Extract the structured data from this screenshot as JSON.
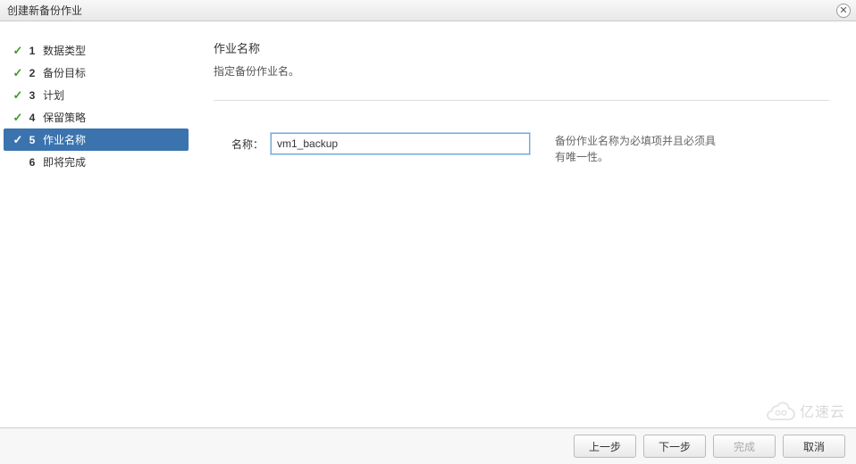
{
  "window": {
    "title": "创建新备份作业",
    "close_glyph": "✕"
  },
  "steps": [
    {
      "num": "1",
      "label": "数据类型",
      "done": true,
      "active": false
    },
    {
      "num": "2",
      "label": "备份目标",
      "done": true,
      "active": false
    },
    {
      "num": "3",
      "label": "计划",
      "done": true,
      "active": false
    },
    {
      "num": "4",
      "label": "保留策略",
      "done": true,
      "active": false
    },
    {
      "num": "5",
      "label": "作业名称",
      "done": true,
      "active": true
    },
    {
      "num": "6",
      "label": "即将完成",
      "done": false,
      "active": false
    }
  ],
  "check_glyph": "✓",
  "main": {
    "title": "作业名称",
    "subtitle": "指定备份作业名。",
    "field_label": "名称：",
    "field_value": "vm1_backup",
    "hint": "备份作业名称为必填项并且必须具有唯一性。"
  },
  "footer": {
    "prev": "上一步",
    "next": "下一步",
    "finish": "完成",
    "cancel": "取消"
  },
  "watermark": {
    "text": "亿速云"
  }
}
